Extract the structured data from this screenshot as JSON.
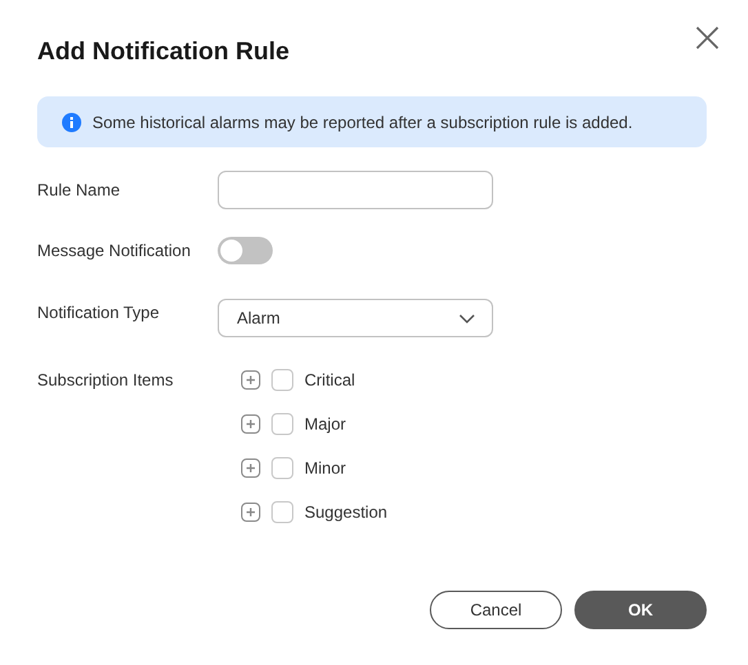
{
  "dialog": {
    "title": "Add Notification Rule"
  },
  "info": "Some historical alarms may be reported after a subscription rule is added.",
  "rule_name": {
    "label": "Rule Name"
  },
  "message_notification": {
    "label": "Message Notification",
    "on": false
  },
  "notification_type": {
    "label": "Notification Type",
    "value": "Alarm"
  },
  "subscription_items": {
    "label": "Subscription Items",
    "items": [
      {
        "label": "Critical",
        "expanded": false,
        "checked": false
      },
      {
        "label": "Major",
        "expanded": false,
        "checked": false
      },
      {
        "label": "Minor",
        "expanded": false,
        "checked": false
      },
      {
        "label": "Suggestion",
        "expanded": false,
        "checked": false
      }
    ]
  },
  "buttons": [
    {
      "label": "Cancel",
      "kind": "secondary"
    },
    {
      "label": "OK",
      "kind": "primary"
    }
  ]
}
